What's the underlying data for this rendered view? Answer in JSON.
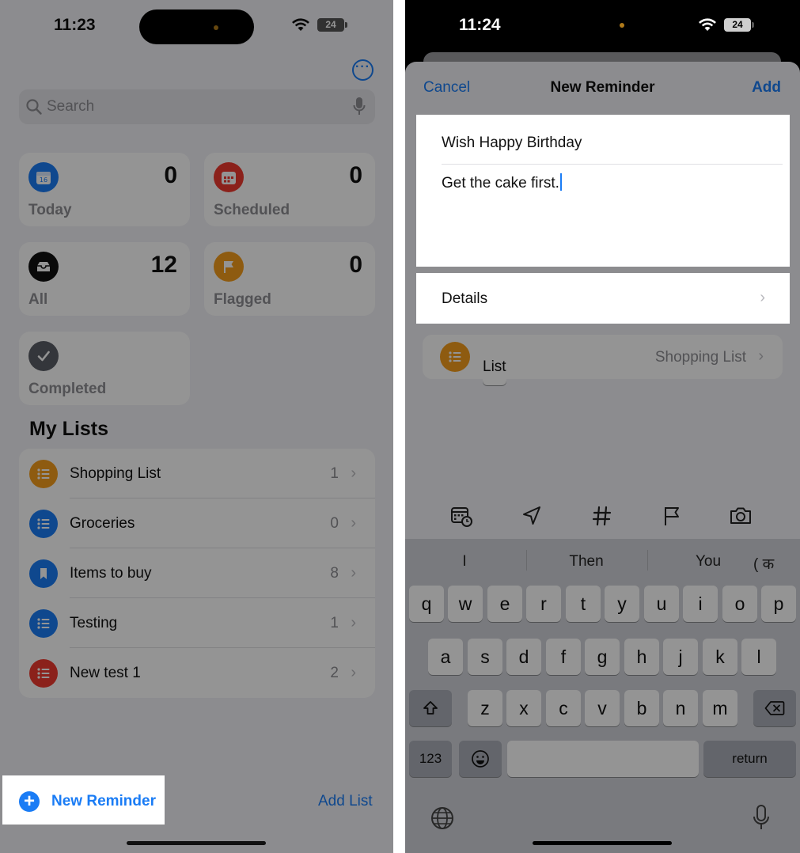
{
  "left_screen": {
    "status": {
      "time": "11:23",
      "battery": "24"
    },
    "search_placeholder": "Search",
    "smart_lists": [
      {
        "label": "Today",
        "count": "0",
        "color": "#1a7cf5",
        "icon": "calendar-icon"
      },
      {
        "label": "Scheduled",
        "count": "0",
        "color": "#f03a2f",
        "icon": "calendar-grid-icon"
      },
      {
        "label": "All",
        "count": "12",
        "color": "#111111",
        "icon": "tray-icon"
      },
      {
        "label": "Flagged",
        "count": "0",
        "color": "#f59e1c",
        "icon": "flag-icon"
      },
      {
        "label": "Completed",
        "count": "",
        "color": "#5b5e66",
        "icon": "checkmark-icon"
      }
    ],
    "my_lists_title": "My Lists",
    "my_lists": [
      {
        "name": "Shopping List",
        "count": "1",
        "color": "#f59e1c",
        "icon": "list-bullet-icon"
      },
      {
        "name": "Groceries",
        "count": "0",
        "color": "#1a7cf5",
        "icon": "list-bullet-icon"
      },
      {
        "name": "Items to buy",
        "count": "8",
        "color": "#1a7cf5",
        "icon": "bookmark-icon"
      },
      {
        "name": "Testing",
        "count": "1",
        "color": "#1a7cf5",
        "icon": "list-bullet-icon"
      },
      {
        "name": "New test 1",
        "count": "2",
        "color": "#f03a2f",
        "icon": "list-bullet-icon"
      }
    ],
    "new_reminder_label": "New Reminder",
    "add_list_label": "Add List"
  },
  "right_screen": {
    "status": {
      "time": "11:24",
      "battery": "24"
    },
    "nav": {
      "cancel": "Cancel",
      "title": "New Reminder",
      "add": "Add"
    },
    "reminder": {
      "title": "Wish Happy Birthday",
      "notes": "Get the cake first."
    },
    "details_label": "Details",
    "list_row": {
      "label": "List",
      "value": "Shopping List"
    },
    "toolbar_icons": [
      "calendar-clock-icon",
      "location-arrow-icon",
      "hashtag-icon",
      "flag-icon",
      "camera-icon"
    ],
    "suggestions": [
      "I",
      "Then",
      "You",
      "( क"
    ],
    "keyboard": {
      "row1": [
        "q",
        "w",
        "e",
        "r",
        "t",
        "y",
        "u",
        "i",
        "o",
        "p"
      ],
      "row2": [
        "a",
        "s",
        "d",
        "f",
        "g",
        "h",
        "j",
        "k",
        "l"
      ],
      "row3": [
        "z",
        "x",
        "c",
        "v",
        "b",
        "n",
        "m"
      ],
      "numbers_key": "123",
      "return_key": "return"
    }
  }
}
